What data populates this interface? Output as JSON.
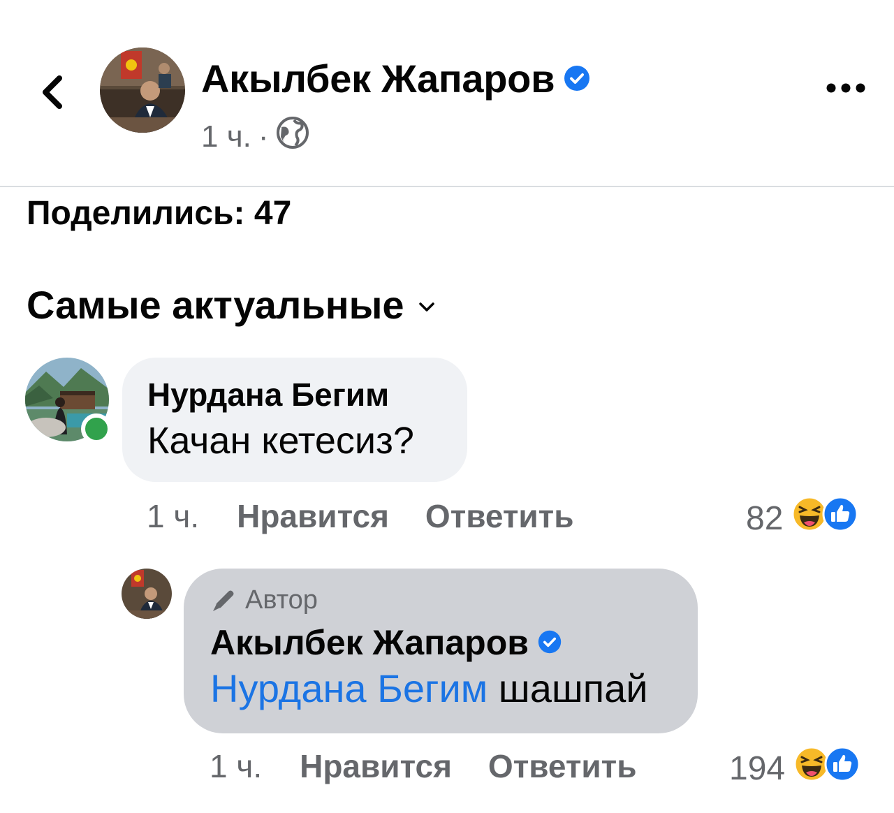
{
  "post": {
    "author": "Акылбек Жапаров",
    "time": "1 ч.",
    "separator": "·",
    "shares_label": "Поделились: 47"
  },
  "sort": {
    "label": "Самые актуальные"
  },
  "comments": [
    {
      "name": "Нурдана Бегим",
      "text": "Качан кетесиз?",
      "time": "1 ч.",
      "like_label": "Нравится",
      "reply_label": "Ответить",
      "reactions_count": "82",
      "online": true
    }
  ],
  "reply": {
    "author_badge": "Автор",
    "name": "Акылбек Жапаров",
    "mention": "Нурдана Бегим",
    "text": "шашпай",
    "time": "1 ч.",
    "like_label": "Нравится",
    "reply_label": "Ответить",
    "reactions_count": "194"
  },
  "colors": {
    "verified": "#1877f2",
    "mention": "#1b74e4",
    "online": "#31a24c",
    "muted": "#65676b",
    "bubble": "#f0f2f5",
    "author_bubble": "#cfd1d6"
  },
  "icons": [
    "back-chevron-icon",
    "verified-icon",
    "globe-icon",
    "more-icon",
    "chevron-down-icon",
    "pencil-icon",
    "haha-reaction-icon",
    "like-reaction-icon"
  ]
}
